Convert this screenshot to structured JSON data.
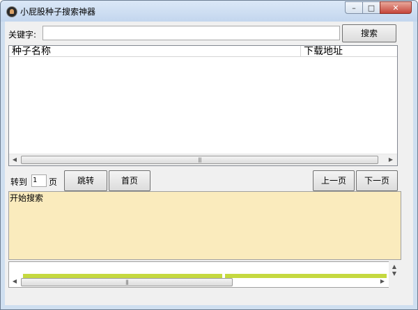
{
  "window": {
    "title": "小屁股种子搜索神器",
    "min_icon": "minimize-icon",
    "max_icon": "maximize-icon",
    "close_icon": "close-icon"
  },
  "search": {
    "label": "关键字:",
    "value": "",
    "button_label": "搜索"
  },
  "results": {
    "columns": [
      "种子名称",
      "下载地址"
    ],
    "rows": []
  },
  "pagination": {
    "goto_label": "转到",
    "page_value": "1",
    "page_unit": "页",
    "jump_label": "跳转",
    "first_label": "首页",
    "prev_label": "上一页",
    "next_label": "下一页"
  },
  "log": {
    "text": "开始搜索"
  },
  "progress": {
    "segment1_fraction": 1.0,
    "segment2_fraction": 1.0
  }
}
